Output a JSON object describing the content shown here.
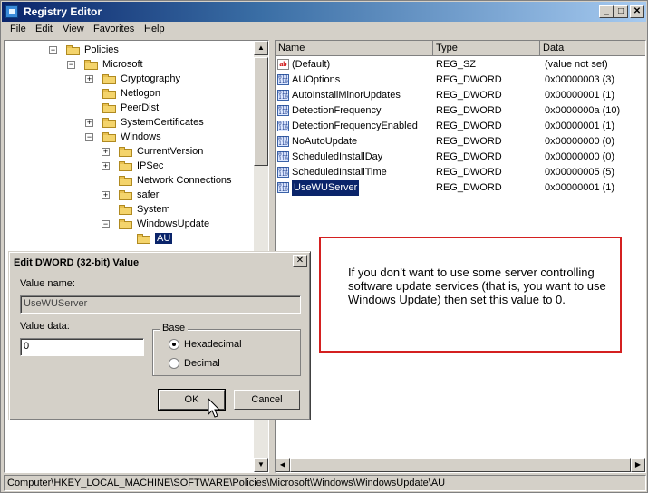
{
  "window": {
    "title": "Registry Editor"
  },
  "menu": [
    "File",
    "Edit",
    "View",
    "Favorites",
    "Help"
  ],
  "tree": [
    {
      "label": "Policies",
      "expander": "−"
    },
    {
      "label": "Microsoft",
      "expander": "−"
    },
    {
      "label": "Cryptography",
      "expander": "+"
    },
    {
      "label": "Netlogon",
      "expander": ""
    },
    {
      "label": "PeerDist",
      "expander": ""
    },
    {
      "label": "SystemCertificates",
      "expander": "+"
    },
    {
      "label": "Windows",
      "expander": "−"
    },
    {
      "label": "CurrentVersion",
      "expander": "+"
    },
    {
      "label": "IPSec",
      "expander": "+"
    },
    {
      "label": "Network Connections",
      "expander": ""
    },
    {
      "label": "safer",
      "expander": "+"
    },
    {
      "label": "System",
      "expander": ""
    },
    {
      "label": "WindowsUpdate",
      "expander": "−"
    },
    {
      "label": "AU",
      "expander": ""
    }
  ],
  "list": {
    "columns": [
      "Name",
      "Type",
      "Data"
    ],
    "rows": [
      {
        "name": "(Default)",
        "type": "REG_SZ",
        "data": "(value not set)",
        "icon": "string-value-icon"
      },
      {
        "name": "AUOptions",
        "type": "REG_DWORD",
        "data": "0x00000003 (3)",
        "icon": "dword-value-icon"
      },
      {
        "name": "AutoInstallMinorUpdates",
        "type": "REG_DWORD",
        "data": "0x00000001 (1)",
        "icon": "dword-value-icon"
      },
      {
        "name": "DetectionFrequency",
        "type": "REG_DWORD",
        "data": "0x0000000a (10)",
        "icon": "dword-value-icon"
      },
      {
        "name": "DetectionFrequencyEnabled",
        "type": "REG_DWORD",
        "data": "0x00000001 (1)",
        "icon": "dword-value-icon"
      },
      {
        "name": "NoAutoUpdate",
        "type": "REG_DWORD",
        "data": "0x00000000 (0)",
        "icon": "dword-value-icon"
      },
      {
        "name": "ScheduledInstallDay",
        "type": "REG_DWORD",
        "data": "0x00000000 (0)",
        "icon": "dword-value-icon"
      },
      {
        "name": "ScheduledInstallTime",
        "type": "REG_DWORD",
        "data": "0x00000005 (5)",
        "icon": "dword-value-icon"
      },
      {
        "name": "UseWUServer",
        "type": "REG_DWORD",
        "data": "0x00000001 (1)",
        "icon": "dword-value-icon"
      }
    ]
  },
  "dialog": {
    "title": "Edit DWORD (32-bit) Value",
    "value_name_label": "Value name:",
    "value_name": "UseWUServer",
    "value_data_label": "Value data:",
    "value_data": "0",
    "base_label": "Base",
    "hex_label": "Hexadecimal",
    "dec_label": "Decimal",
    "ok_label": "OK",
    "cancel_label": "Cancel"
  },
  "note": "If you don’t want to use some server controlling software update services (that is, you want to use Windows Update) then set this value to 0.",
  "status": "Computer\\HKEY_LOCAL_MACHINE\\SOFTWARE\\Policies\\Microsoft\\Windows\\WindowsUpdate\\AU"
}
